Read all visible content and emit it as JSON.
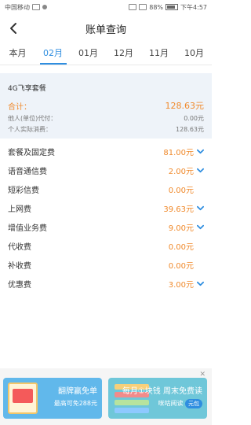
{
  "status_bar": {
    "carrier": "中国移动",
    "battery": "88%",
    "time": "下午4:57"
  },
  "header": {
    "title": "账单查询"
  },
  "tabs": [
    {
      "label": "本月",
      "active": false
    },
    {
      "label": "02月",
      "active": true
    },
    {
      "label": "01月",
      "active": false
    },
    {
      "label": "12月",
      "active": false
    },
    {
      "label": "11月",
      "active": false
    },
    {
      "label": "10月",
      "active": false
    }
  ],
  "summary": {
    "plan_name": "4G飞享套餐",
    "total_label": "合计：",
    "total_value": "128.63元",
    "paid_by_other_label": "他人(单位)代付：",
    "paid_by_other_value": "0.00元",
    "actual_consumption_label": "个人实际消费：",
    "actual_consumption_value": "128.63元"
  },
  "fees": [
    {
      "name": "套餐及固定费",
      "amount": "81.00元",
      "expandable": true
    },
    {
      "name": "语音通信费",
      "amount": "2.00元",
      "expandable": true
    },
    {
      "name": "短彩信费",
      "amount": "0.00元",
      "expandable": false
    },
    {
      "name": "上网费",
      "amount": "39.63元",
      "expandable": true
    },
    {
      "name": "增值业务费",
      "amount": "9.00元",
      "expandable": true
    },
    {
      "name": "代收费",
      "amount": "0.00元",
      "expandable": false
    },
    {
      "name": "补收费",
      "amount": "0.00元",
      "expandable": false
    },
    {
      "name": "优惠费",
      "amount": "3.00元",
      "expandable": true
    }
  ],
  "ads": {
    "left": {
      "title": "翻牌赢免单",
      "subtitle": "最高可免288元"
    },
    "right": {
      "title": "每月①块钱 周末免费读",
      "subtitle": "咪咕阅读",
      "badge": "元包"
    }
  }
}
